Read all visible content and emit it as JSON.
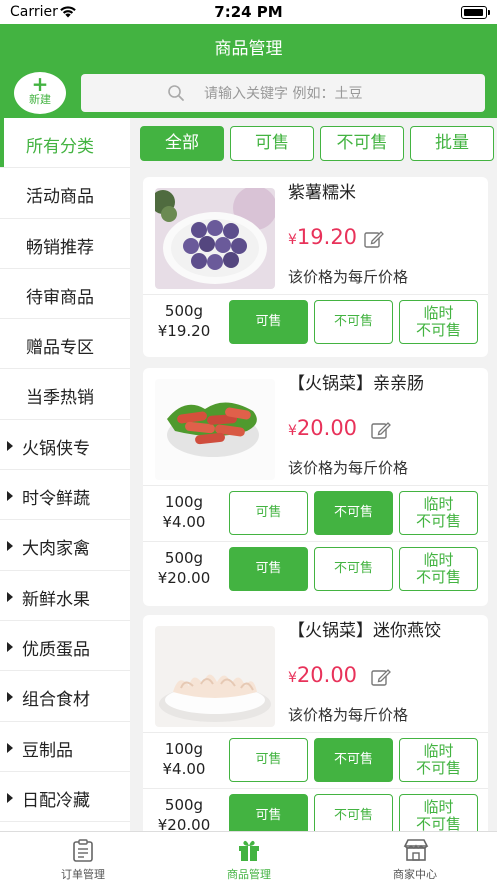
{
  "status_bar": {
    "carrier": "Carrier",
    "time": "7:24 PM"
  },
  "header": {
    "title": "商品管理",
    "new_plus": "+",
    "new_label": "新建",
    "search_placeholder": "请输入关键字 例如：土豆"
  },
  "sidebar": {
    "items": [
      {
        "label": "所有分类",
        "arrow": false,
        "active": true
      },
      {
        "label": "活动商品",
        "arrow": false
      },
      {
        "label": "畅销推荐",
        "arrow": false
      },
      {
        "label": "待审商品",
        "arrow": false
      },
      {
        "label": "赠品专区",
        "arrow": false
      },
      {
        "label": "当季热销",
        "arrow": false
      },
      {
        "label": "火锅侠专",
        "arrow": true
      },
      {
        "label": "时令鲜蔬",
        "arrow": true
      },
      {
        "label": "大肉家禽",
        "arrow": true
      },
      {
        "label": "新鲜水果",
        "arrow": true
      },
      {
        "label": "优质蛋品",
        "arrow": true
      },
      {
        "label": "组合食材",
        "arrow": true
      },
      {
        "label": "豆制品",
        "arrow": true
      },
      {
        "label": "日配冷藏",
        "arrow": true
      }
    ]
  },
  "filters": {
    "all": "全部",
    "sellable": "可售",
    "unsellable": "不可售",
    "batch": "批量"
  },
  "buttons": {
    "sell": "可售",
    "no_sell": "不可售",
    "temp_line1": "临时",
    "temp_line2": "不可售"
  },
  "products": [
    {
      "name": "紫薯糯米",
      "currency": "¥",
      "price": "19.20",
      "note": "该价格为每斤价格",
      "image": "purple-sweet-potato-rice-balls",
      "specs": [
        {
          "weight": "500g",
          "price": "¥19.20",
          "state": "sellable"
        }
      ]
    },
    {
      "name": "【火锅菜】亲亲肠",
      "currency": "¥",
      "price": "20.00",
      "note": "该价格为每斤价格",
      "image": "mini-sausages",
      "specs": [
        {
          "weight": "100g",
          "price": "¥4.00",
          "state": "unsellable"
        },
        {
          "weight": "500g",
          "price": "¥20.00",
          "state": "sellable"
        }
      ]
    },
    {
      "name": "【火锅菜】迷你燕饺",
      "currency": "¥",
      "price": "20.00",
      "note": "该价格为每斤价格",
      "image": "mini-dumplings",
      "specs": [
        {
          "weight": "100g",
          "price": "¥4.00",
          "state": "unsellable"
        },
        {
          "weight": "500g",
          "price": "¥20.00",
          "state": "sellable"
        }
      ]
    }
  ],
  "tab_bar": {
    "orders": "订单管理",
    "products": "商品管理",
    "merchant": "商家中心",
    "active": "products"
  },
  "colors": {
    "brand": "#43b341",
    "price": "#e8325a"
  }
}
